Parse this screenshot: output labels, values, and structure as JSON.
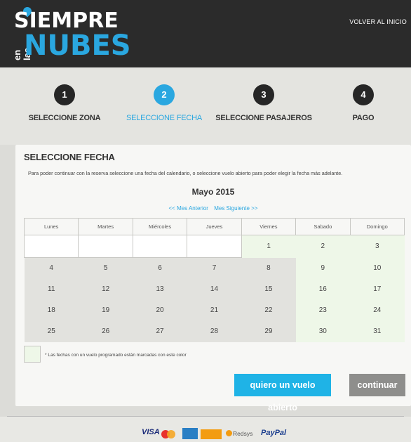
{
  "header": {
    "logo_top": "SIEMPRE",
    "logo_side": "en las",
    "logo_bottom": "NUBES",
    "volver_label": "VOLVER AL INICIO",
    "brand_color": "#2aa7e0"
  },
  "steps": [
    {
      "number": "1",
      "label": "SELECCIONE ZONA",
      "active": false
    },
    {
      "number": "2",
      "label": "SELECCIONE FECHA",
      "active": true
    },
    {
      "number": "3",
      "label": "SELECCIONE PASAJEROS",
      "active": false
    },
    {
      "number": "4",
      "label": "PAGO",
      "active": false
    }
  ],
  "panel": {
    "title": "SELECCIONE FECHA",
    "description": "Para poder continuar con la reserva seleccione una fecha del calendario, o seleccione vuelo abierto para poder elegir la fecha más adelante.",
    "month": "Mayo 2015",
    "prev_label": "<< Mes Anterior",
    "next_label": "Mes Siguiente >>",
    "weekdays": [
      "Lunes",
      "Martes",
      "Miércoles",
      "Jueves",
      "Viernes",
      "Sabado",
      "Domingo"
    ],
    "weeks": [
      [
        "",
        "",
        "",
        "",
        "1",
        "2",
        "3"
      ],
      [
        "4",
        "5",
        "6",
        "7",
        "8",
        "9",
        "10"
      ],
      [
        "11",
        "12",
        "13",
        "14",
        "15",
        "16",
        "17"
      ],
      [
        "18",
        "19",
        "20",
        "21",
        "22",
        "23",
        "24"
      ],
      [
        "25",
        "26",
        "27",
        "28",
        "29",
        "30",
        "31"
      ]
    ],
    "legend_text": "* Las fechas con un vuelo programado están marcadas con este color",
    "open_flight_button": "quiero un vuelo abierto",
    "continue_button": "continuar"
  },
  "footer": {
    "payment_methods": [
      "VISA",
      "mastercard-icon",
      "amex-icon",
      "maestro-icon",
      "Redsys",
      "PayPal"
    ],
    "visa": "VISA",
    "redsys": "Redsys",
    "paypal": "PayPal"
  }
}
